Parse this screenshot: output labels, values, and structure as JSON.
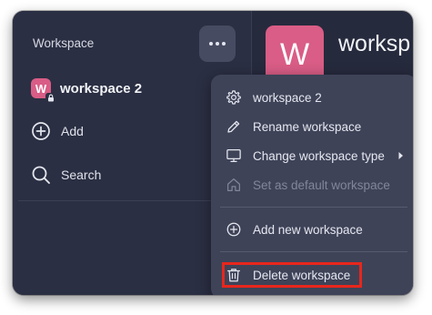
{
  "sidebar": {
    "title": "Workspace",
    "workspace": {
      "avatar_letter": "W",
      "name": "workspace 2"
    },
    "add_label": "Add",
    "search_label": "Search"
  },
  "main": {
    "avatar_letter": "W",
    "title": "worksp"
  },
  "menu": {
    "items": [
      {
        "label": "workspace 2",
        "icon": "gear-icon"
      },
      {
        "label": "Rename workspace",
        "icon": "pencil-icon"
      },
      {
        "label": "Change workspace type",
        "icon": "monitor-icon",
        "submenu": true
      },
      {
        "label": "Set as default workspace",
        "icon": "home-icon",
        "disabled": true
      },
      {
        "label": "Add new workspace",
        "icon": "plus-circle-icon"
      },
      {
        "label": "Delete workspace",
        "icon": "trash-icon",
        "highlighted": true
      }
    ]
  },
  "colors": {
    "window_bg": "#262a3d",
    "menu_bg": "#3f4358",
    "avatar_pink": "#d95d86",
    "highlight_red": "#e8261c"
  }
}
